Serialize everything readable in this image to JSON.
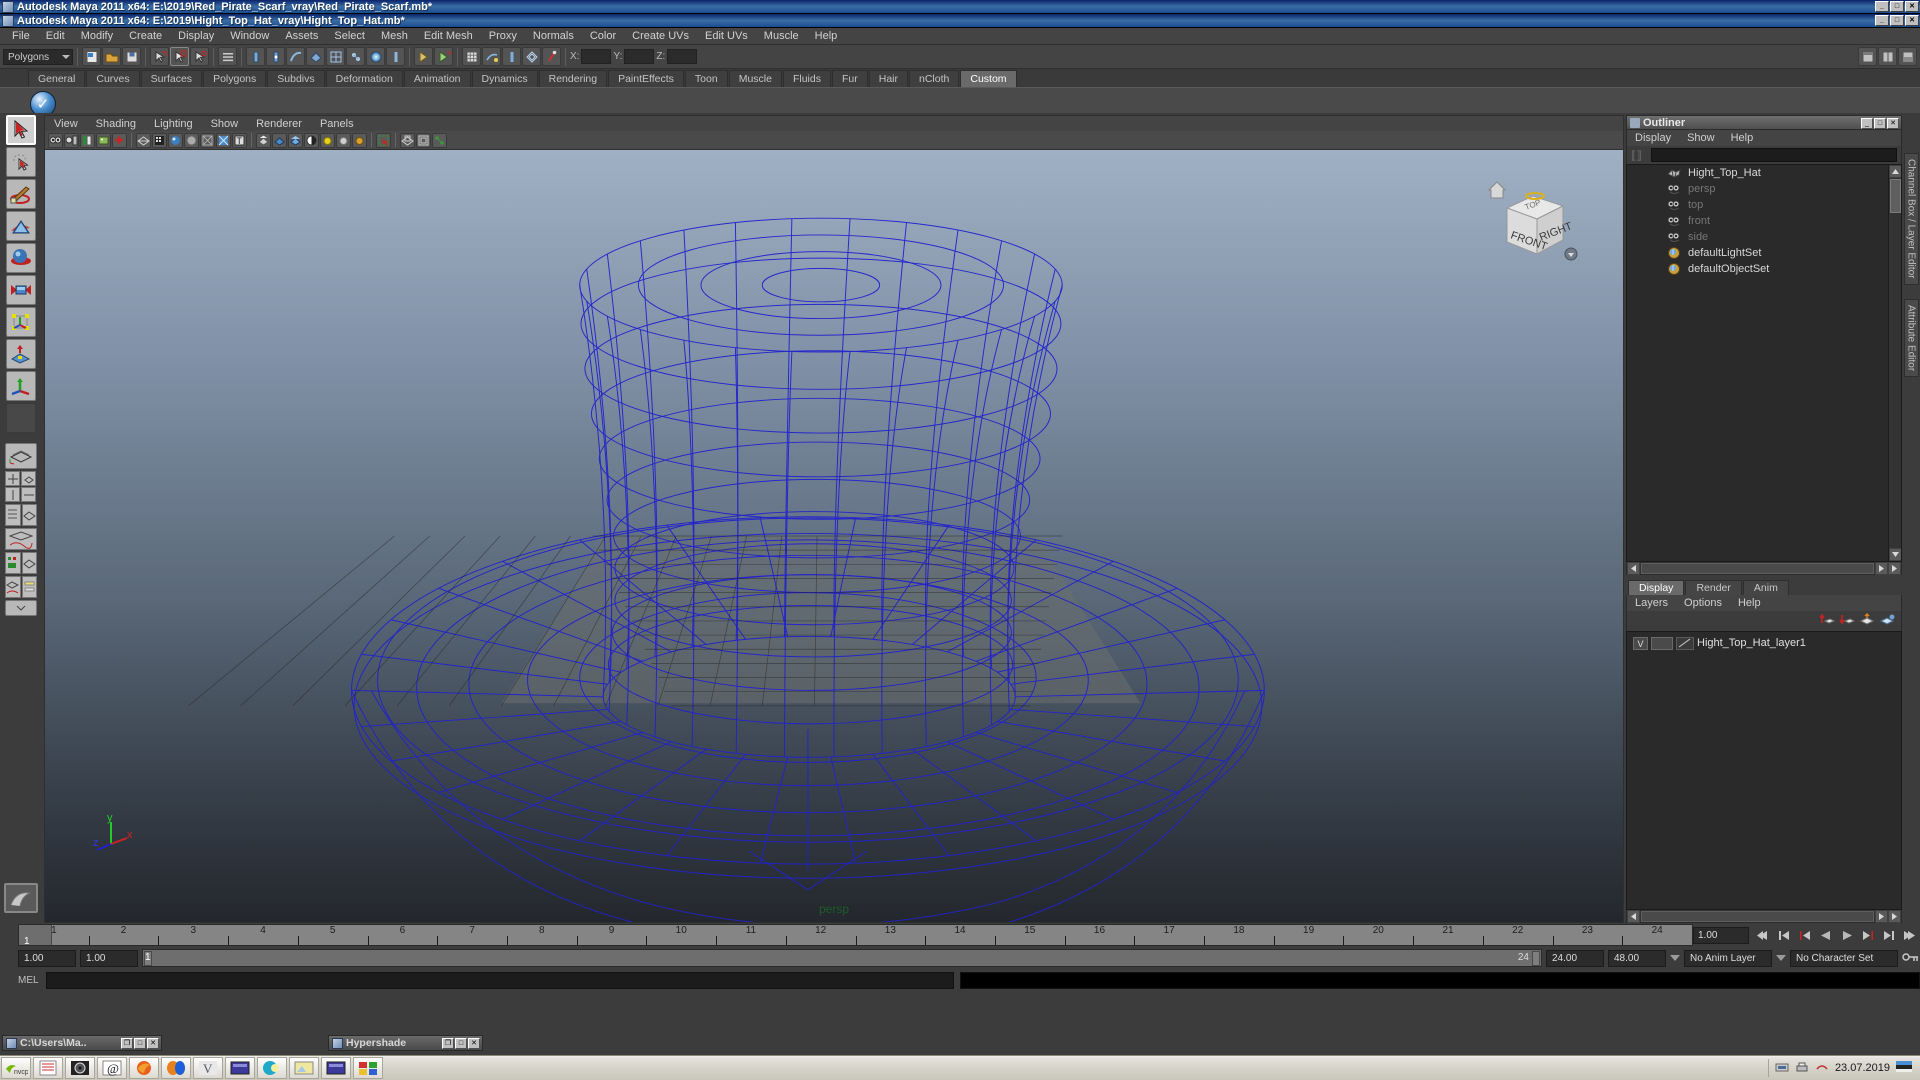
{
  "window": {
    "title_back": "Autodesk Maya 2011 x64: E:\\2019\\Red_Pirate_Scarf_vray\\Red_Pirate_Scarf.mb*",
    "title_front": "Autodesk Maya 2011 x64: E:\\2019\\Hight_Top_Hat_vray\\Hight_Top_Hat.mb*",
    "buttons": {
      "minimize": "_",
      "maximize": "□",
      "close": "✕"
    }
  },
  "menubar": {
    "items": [
      "File",
      "Edit",
      "Modify",
      "Create",
      "Display",
      "Window",
      "Assets",
      "Select",
      "Mesh",
      "Edit Mesh",
      "Proxy",
      "Normals",
      "Color",
      "Create UVs",
      "Edit UVs",
      "Muscle",
      "Help"
    ]
  },
  "toolbar": {
    "menuset_value": "Polygons",
    "coord_labels": [
      "X:",
      "Y:",
      "Z:"
    ],
    "coord_values": [
      "",
      "",
      ""
    ]
  },
  "shelf": {
    "tabs": [
      "General",
      "Curves",
      "Surfaces",
      "Polygons",
      "Subdivs",
      "Deformation",
      "Animation",
      "Dynamics",
      "Rendering",
      "PaintEffects",
      "Toon",
      "Muscle",
      "Fluids",
      "Fur",
      "Hair",
      "nCloth",
      "Custom"
    ],
    "active_tab": "Custom",
    "button_icon": "checkmark-sphere-icon"
  },
  "toolbox": {
    "tools": [
      {
        "name": "select-tool",
        "icon": "arrow-cursor-icon",
        "selected": true
      },
      {
        "name": "lasso-tool",
        "icon": "lasso-icon",
        "selected": false
      },
      {
        "name": "paint-select-tool",
        "icon": "paintbrush-icon",
        "selected": false
      },
      {
        "name": "move-tool",
        "icon": "move-arrows-icon",
        "selected": false
      },
      {
        "name": "rotate-tool",
        "icon": "rotate-circle-icon",
        "selected": false
      },
      {
        "name": "scale-tool",
        "icon": "scale-box-icon",
        "selected": false
      },
      {
        "name": "universal-manip-tool",
        "icon": "universal-manipulator-icon",
        "selected": false
      },
      {
        "name": "soft-mod-tool",
        "icon": "soft-mod-icon",
        "selected": false
      },
      {
        "name": "show-manip-tool",
        "icon": "show-manip-icon",
        "selected": false
      },
      {
        "name": "last-tool",
        "icon": "blank-icon",
        "selected": false
      }
    ],
    "layout_presets": [
      "single-perspective-view",
      "four-view",
      "two-panes-side",
      "two-panes-stacked",
      "outliner-persp",
      "hypergraph-persp",
      "persp-graph-editor",
      "outliner-graph",
      "persp-trax"
    ],
    "paint_effects_icon": "paint-effects-icon"
  },
  "viewport": {
    "menus": [
      "View",
      "Shading",
      "Lighting",
      "Show",
      "Renderer",
      "Panels"
    ],
    "camera_label": "persp",
    "axis_labels": {
      "x": "x",
      "y": "y",
      "z": "z"
    },
    "viewcube": {
      "front": "FRONT",
      "right": "RIGHT",
      "top": "TOP",
      "home_icon": "home-icon",
      "menu_icon": "viewcube-menu-icon"
    },
    "model": "Hight_Top_Hat wireframe top hat",
    "wireframe_color": "#2222cc",
    "icons": [
      "select-camera-icon",
      "camera-attributes-icon",
      "image-plane-icon",
      "paint-icon",
      "ipr-icon",
      "wireframe-icon",
      "smooth-shade-icon",
      "textured-icon",
      "flat-shade-icon",
      "xray-icon",
      "xray-joints-icon",
      "texture-borders-icon",
      "light-default-icon",
      "light-all-icon",
      "light-shadows-icon",
      "isolate-select-icon",
      "grid-icon",
      "film-gate-icon",
      "resolution-gate-icon"
    ]
  },
  "outliner": {
    "title": "Outliner",
    "menus": [
      "Display",
      "Show",
      "Help"
    ],
    "search_value": "",
    "items": [
      {
        "label": "Hight_Top_Hat",
        "icon": "mesh-icon",
        "dim": false
      },
      {
        "label": "persp",
        "icon": "camera-icon",
        "dim": true
      },
      {
        "label": "top",
        "icon": "camera-icon",
        "dim": true
      },
      {
        "label": "front",
        "icon": "camera-icon",
        "dim": true
      },
      {
        "label": "side",
        "icon": "camera-icon",
        "dim": true
      },
      {
        "label": "defaultLightSet",
        "icon": "set-icon",
        "dim": false
      },
      {
        "label": "defaultObjectSet",
        "icon": "set-icon",
        "dim": false
      }
    ]
  },
  "layers_panel": {
    "tabs": [
      "Display",
      "Render",
      "Anim"
    ],
    "active_tab": "Display",
    "menus": [
      "Layers",
      "Options",
      "Help"
    ],
    "tool_icons": [
      "move-layer-up-icon",
      "move-layer-down-icon",
      "new-layer-icon",
      "new-layer-from-selected-icon"
    ],
    "layers": [
      {
        "visibility": "V",
        "display_type": "",
        "name": "Hight_Top_Hat_layer1"
      }
    ]
  },
  "right_tabs": [
    "Channel Box / Layer Editor",
    "Attribute Editor"
  ],
  "timeline": {
    "start_tick": 1,
    "end_tick": 24,
    "ticks": [
      1,
      2,
      3,
      4,
      5,
      6,
      7,
      8,
      9,
      10,
      11,
      12,
      13,
      14,
      15,
      16,
      17,
      18,
      19,
      20,
      21,
      22,
      23,
      24
    ],
    "current_frame": "1",
    "current_time_field": "1.00",
    "playback_buttons": [
      "go-to-start-icon",
      "step-back-key-icon",
      "step-back-frame-icon",
      "play-backwards-icon",
      "play-forwards-icon",
      "step-forward-frame-icon",
      "step-forward-key-icon",
      "go-to-end-icon"
    ]
  },
  "range": {
    "anim_start": "1.00",
    "range_start": "1.00",
    "range_left_label": "1",
    "range_right_label": "24",
    "range_end": "24.00",
    "anim_end": "48.00",
    "anim_layer": "No Anim Layer",
    "character_set": "No Character Set",
    "key_icon": "key-icon"
  },
  "mel": {
    "label": "MEL",
    "input_value": "",
    "output_value": ""
  },
  "minimized_windows": [
    {
      "title": "C:\\Users\\Ma..",
      "icon": "maya-icon",
      "buttons": [
        "restore",
        "maximize",
        "close"
      ]
    },
    {
      "title": "Hypershade",
      "icon": "maya-icon",
      "buttons": [
        "restore",
        "maximize",
        "close"
      ]
    }
  ],
  "taskbar": {
    "quick_launch": [
      {
        "name": "nvidia-icon",
        "label": "nvcpl"
      },
      {
        "name": "notepad-icon",
        "label": ""
      },
      {
        "name": "media-app-icon",
        "label": ""
      },
      {
        "name": "photoshop-icon",
        "label": ""
      },
      {
        "name": "firefox-icon",
        "label": ""
      },
      {
        "name": "opera-icon",
        "label": ""
      },
      {
        "name": "vray-icon",
        "label": ""
      },
      {
        "name": "explorer-window-icon",
        "label": ""
      },
      {
        "name": "teal-app-icon",
        "label": ""
      },
      {
        "name": "image-viewer-icon",
        "label": ""
      },
      {
        "name": "explorer-window2-icon",
        "label": ""
      },
      {
        "name": "colorful-app-icon",
        "label": ""
      }
    ],
    "tray": {
      "icons": [
        "network-icon",
        "printer-icon",
        "keyboard-layout-icon"
      ],
      "date": "23.07.2019",
      "lang_icon": "language-flag-icon"
    }
  },
  "colors": {
    "maya_bg": "#3c3c3c",
    "title_blue": "#0a246a",
    "accent_wire": "#2222cc",
    "shelf_active": "#6a6a6a",
    "taskbar": "#d6d3ca"
  }
}
